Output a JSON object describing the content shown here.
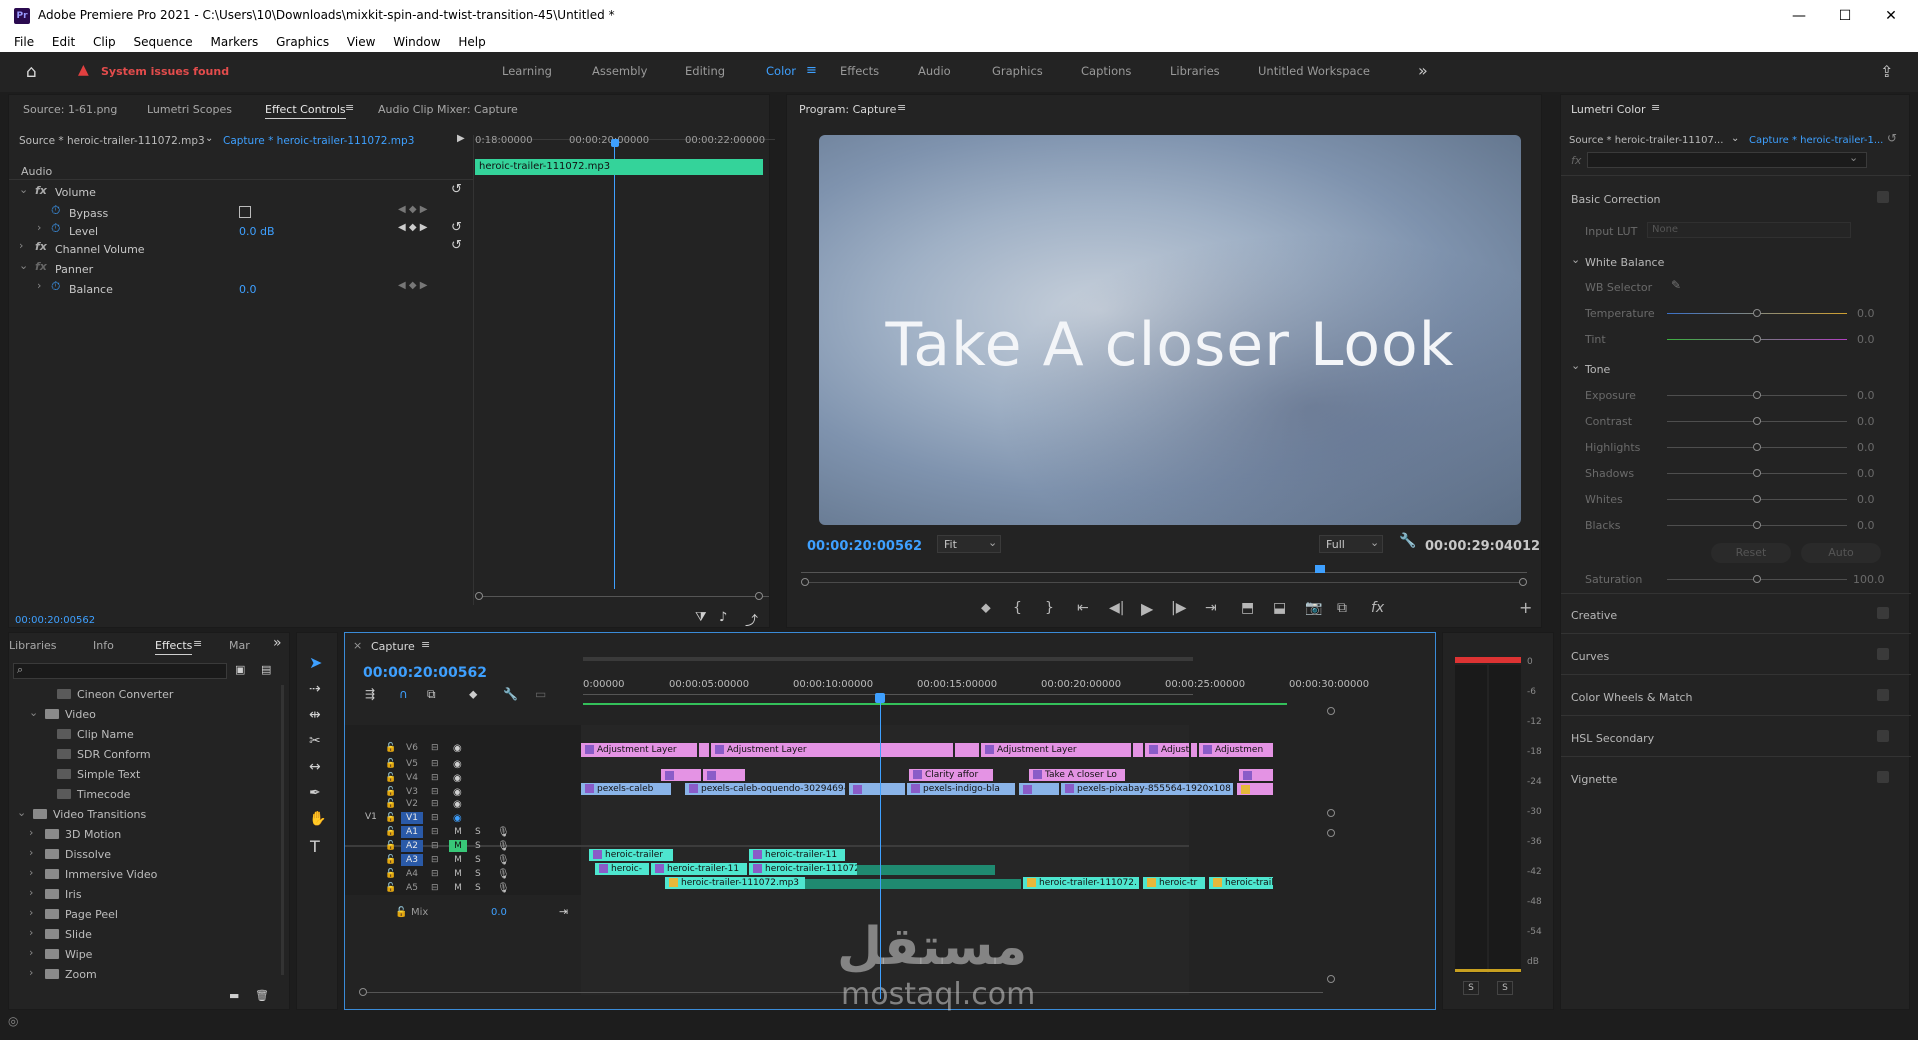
{
  "window": {
    "app_badge": "Pr",
    "title": "Adobe Premiere Pro 2021 - C:\\Users\\10\\Downloads\\mixkit-spin-and-twist-transition-45\\Untitled *",
    "min": "—",
    "max": "☐",
    "close": "✕"
  },
  "menu": [
    "File",
    "Edit",
    "Clip",
    "Sequence",
    "Markers",
    "Graphics",
    "View",
    "Window",
    "Help"
  ],
  "workspace": {
    "alert": "System issues found",
    "tabs": [
      "Learning",
      "Assembly",
      "Editing",
      "Color",
      "Effects",
      "Audio",
      "Graphics",
      "Captions",
      "Libraries",
      "Untitled Workspace"
    ],
    "active": "Color",
    "more": "»"
  },
  "effect_controls": {
    "tabs": [
      "Source: 1-61.png",
      "Lumetri Scopes",
      "Effect Controls",
      "Lumetri Audio Clip Mixer: Capture"
    ],
    "tab_labels": [
      "Source: 1-61.png",
      "Lumetri Scopes",
      "Effect Controls",
      "Audio Clip Mixer: Capture"
    ],
    "source": "Source * heroic-trailer-111072.mp3",
    "target": "Capture * heroic-trailer-111072.mp3",
    "times": [
      "0:18:00000",
      "00:00:20:00000",
      "00:00:22:00000"
    ],
    "clip_name": "heroic-trailer-111072.mp3",
    "section": "Audio",
    "rows": {
      "volume": "Volume",
      "bypass": "Bypass",
      "level": "Level",
      "level_value": "0.0 dB",
      "channel_volume": "Channel Volume",
      "panner": "Panner",
      "balance": "Balance",
      "balance_value": "0.0"
    },
    "timecode": "00:00:20:00562"
  },
  "program": {
    "title": "Program: Capture",
    "overlay_text": "Take A closer Look",
    "timecode": "00:00:20:00562",
    "fit": "Fit",
    "quality": "Full",
    "duration": "00:00:29:04012"
  },
  "lumetri": {
    "title": "Lumetri Color",
    "source": "Source * heroic-trailer-11107...",
    "target": "Capture * heroic-trailer-1...",
    "fx": "fx",
    "basic_correction": "Basic Correction",
    "input_lut": "Input LUT",
    "input_lut_value": "None",
    "white_balance": "White Balance",
    "wb_selector": "WB Selector",
    "temperature": "Temperature",
    "tint": "Tint",
    "tone": "Tone",
    "tone_rows": [
      "Exposure",
      "Contrast",
      "Highlights",
      "Shadows",
      "Whites",
      "Blacks"
    ],
    "value": "0.0",
    "reset": "Reset",
    "auto": "Auto",
    "saturation": "Saturation",
    "saturation_value": "100.0",
    "sections": [
      "Creative",
      "Curves",
      "Color Wheels & Match",
      "HSL Secondary",
      "Vignette"
    ]
  },
  "effects_panel": {
    "tabs": [
      "Libraries",
      "Info",
      "Effects",
      "Mar"
    ],
    "items": [
      {
        "label": "Cineon Converter",
        "indent": 2,
        "type": "file"
      },
      {
        "label": "Video",
        "indent": 1,
        "type": "folder"
      },
      {
        "label": "Clip Name",
        "indent": 2,
        "type": "file"
      },
      {
        "label": "SDR Conform",
        "indent": 2,
        "type": "file"
      },
      {
        "label": "Simple Text",
        "indent": 2,
        "type": "file"
      },
      {
        "label": "Timecode",
        "indent": 2,
        "type": "file"
      },
      {
        "label": "Video Transitions",
        "indent": 0,
        "type": "folder"
      },
      {
        "label": "3D Motion",
        "indent": 1,
        "type": "folder"
      },
      {
        "label": "Dissolve",
        "indent": 1,
        "type": "folder"
      },
      {
        "label": "Immersive Video",
        "indent": 1,
        "type": "folder"
      },
      {
        "label": "Iris",
        "indent": 1,
        "type": "folder"
      },
      {
        "label": "Page Peel",
        "indent": 1,
        "type": "folder"
      },
      {
        "label": "Slide",
        "indent": 1,
        "type": "folder"
      },
      {
        "label": "Wipe",
        "indent": 1,
        "type": "folder"
      },
      {
        "label": "Zoom",
        "indent": 1,
        "type": "folder"
      }
    ]
  },
  "timeline": {
    "title": "Capture",
    "timecode": "00:00:20:00562",
    "ruler": [
      "0:00000",
      "00:00:05:00000",
      "00:00:10:00000",
      "00:00:15:00000",
      "00:00:20:00000",
      "00:00:25:00000",
      "00:00:30:00000"
    ],
    "tracks": [
      "V6",
      "V5",
      "V4",
      "V3",
      "V2",
      "V1",
      "A1",
      "A2",
      "A3",
      "A4",
      "A5"
    ],
    "source_patch": "V1",
    "mix": "Mix",
    "mix_value": "0.0",
    "clips": {
      "v6": [
        "Adjustment Layer",
        "Adjustment Layer",
        "Adjustment Layer",
        "Adjust",
        "Adjustmen"
      ],
      "v5": [
        "Clarity affor",
        "Take A closer Lo"
      ],
      "v4": [
        "pexels-caleb",
        "pexels-caleb-oquendo-3029469-",
        "pexels-indigo-bla",
        "pexels-pixabay-855564-1920x108"
      ],
      "a1": [
        "heroic-trailer",
        "heroic-trailer-11"
      ],
      "a2": [
        "heroic-",
        "heroic-trailer-11",
        "heroic-trailer-111072.mp3"
      ],
      "a3": [
        "heroic-trailer-111072.mp3",
        "heroic-trailer-111072.",
        "heroic-tr",
        "heroic-trail"
      ]
    },
    "track_letters": {
      "m": "M",
      "s": "S"
    }
  },
  "meter": {
    "ticks": [
      "0",
      "-6",
      "-12",
      "-18",
      "-24",
      "-30",
      "-36",
      "-42",
      "-48",
      "-54",
      "dB"
    ],
    "solo": [
      "S",
      "S"
    ]
  },
  "watermark": {
    "arabic": "مستقل",
    "latin": "mostaql.com"
  }
}
